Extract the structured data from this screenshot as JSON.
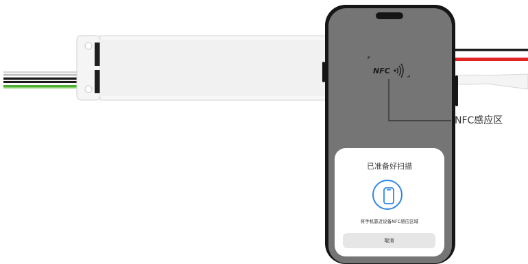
{
  "nfc_area": {
    "chip_label": "NFC",
    "leader_label": "NFC感应区"
  },
  "scan_sheet": {
    "title": "已准备好扫描",
    "icon": "phone-icon",
    "hint": "将手机靠近设备NFC感应区域",
    "cancel_label": "取消"
  },
  "colors": {
    "scan_accent": "#2f86e6",
    "wire_red": "#e32424",
    "wire_green": "#4caf34",
    "wire_black": "#1a1a1a",
    "phone_overlay": "#8a8a8a"
  }
}
